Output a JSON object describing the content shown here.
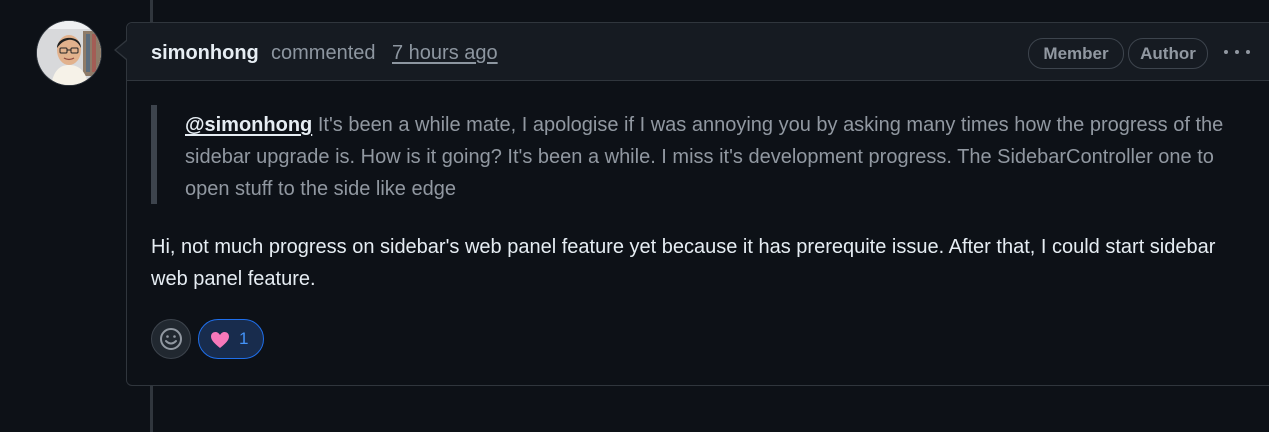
{
  "comment": {
    "author": "simonhong",
    "verb": "commented",
    "timestamp": "7 hours ago",
    "badges": [
      "Member",
      "Author"
    ],
    "quote": {
      "mention": "@simonhong",
      "text": "It's been a while mate, I apologise if I was annoying you by asking many times how the progress of the sidebar upgrade is. How is it going? It's been a while. I miss it's development progress. The SidebarController one to open stuff to the side like edge"
    },
    "body": "Hi, not much progress on sidebar's web panel feature yet because it has prerequite issue. After that, I could start sidebar web panel feature.",
    "reactions": [
      {
        "icon": "heart-icon",
        "count": "1"
      }
    ]
  },
  "icons": {
    "more": "kebab-horizontal-icon",
    "add_reaction": "smiley-icon"
  },
  "colors": {
    "background": "#0d1117",
    "header": "#161b22",
    "border": "#30363d",
    "muted_text": "#9198a1",
    "reaction_accent": "#1f6feb",
    "heart": "#f778ba"
  }
}
